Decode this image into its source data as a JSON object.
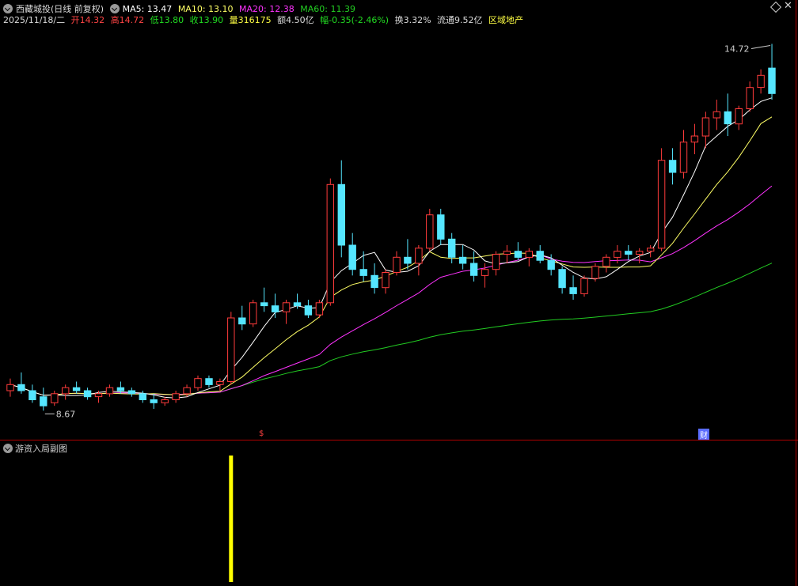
{
  "header": {
    "stock": "西藏城投",
    "mode": "(日线 前复权)",
    "ma5": "MA5: 13.47",
    "ma10": "MA10: 13.10",
    "ma20": "MA20: 12.38",
    "ma60": "MA60: 11.39",
    "date": "2025/11/18/二",
    "open_label": "开",
    "open": "14.32",
    "high_label": "高",
    "high": "14.72",
    "low_label": "低",
    "low": "13.80",
    "close_label": "收",
    "close": "13.90",
    "vol_label": "量",
    "vol": "316175",
    "amount_label": "额",
    "amount": "4.50亿",
    "chg_label": "幅",
    "chg": "-0.35(-2.46%)",
    "turnover_label": "换",
    "turnover": "3.32%",
    "float_label": "流通",
    "float": "9.52亿",
    "sector": "区域地产"
  },
  "colors": {
    "up": "#ff3b3b",
    "down": "#55e6ff",
    "ma5": "#ffffff",
    "ma10": "#ffff66",
    "ma20": "#ff33ff",
    "ma60": "#22cc22"
  },
  "annotations": {
    "high_label": "14.72",
    "low_label": "8.67",
    "s_badge": "$",
    "fin_badge": "财"
  },
  "subchart": {
    "title": "游资入局副图",
    "bar_color": "#ffff00"
  },
  "chart_data": {
    "type": "candlestick",
    "ohlc": [
      [
        9.0,
        9.2,
        8.9,
        9.1
      ],
      [
        9.1,
        9.3,
        8.95,
        9.0
      ],
      [
        9.0,
        9.1,
        8.8,
        8.85
      ],
      [
        8.9,
        9.05,
        8.67,
        8.75
      ],
      [
        8.8,
        9.0,
        8.75,
        8.95
      ],
      [
        8.95,
        9.1,
        8.85,
        9.05
      ],
      [
        9.05,
        9.15,
        8.95,
        9.0
      ],
      [
        9.0,
        9.05,
        8.85,
        8.9
      ],
      [
        8.9,
        9.0,
        8.8,
        8.95
      ],
      [
        8.95,
        9.1,
        8.9,
        9.05
      ],
      [
        9.05,
        9.15,
        8.95,
        9.0
      ],
      [
        9.0,
        9.05,
        8.9,
        8.95
      ],
      [
        8.95,
        9.0,
        8.8,
        8.85
      ],
      [
        8.85,
        8.95,
        8.7,
        8.8
      ],
      [
        8.8,
        8.9,
        8.75,
        8.85
      ],
      [
        8.85,
        9.0,
        8.8,
        8.95
      ],
      [
        8.95,
        9.1,
        8.9,
        9.05
      ],
      [
        9.05,
        9.25,
        9.0,
        9.2
      ],
      [
        9.2,
        9.25,
        9.05,
        9.1
      ],
      [
        9.1,
        9.2,
        9.0,
        9.15
      ],
      [
        9.15,
        10.3,
        9.1,
        10.2
      ],
      [
        10.2,
        10.4,
        10.0,
        10.1
      ],
      [
        10.1,
        10.5,
        10.05,
        10.45
      ],
      [
        10.45,
        10.7,
        10.3,
        10.4
      ],
      [
        10.4,
        10.6,
        10.2,
        10.3
      ],
      [
        10.3,
        10.5,
        10.1,
        10.45
      ],
      [
        10.45,
        10.6,
        10.35,
        10.4
      ],
      [
        10.4,
        10.5,
        10.2,
        10.25
      ],
      [
        10.25,
        10.5,
        10.2,
        10.45
      ],
      [
        10.45,
        12.5,
        10.4,
        12.4
      ],
      [
        12.4,
        12.8,
        11.2,
        11.4
      ],
      [
        11.4,
        11.6,
        10.9,
        11.0
      ],
      [
        11.0,
        11.3,
        10.8,
        10.9
      ],
      [
        10.9,
        11.1,
        10.6,
        10.7
      ],
      [
        10.7,
        11.0,
        10.6,
        10.95
      ],
      [
        10.95,
        11.3,
        10.9,
        11.2
      ],
      [
        11.2,
        11.5,
        11.0,
        11.1
      ],
      [
        11.1,
        11.4,
        10.9,
        11.35
      ],
      [
        11.35,
        12.0,
        11.3,
        11.9
      ],
      [
        11.9,
        12.0,
        11.4,
        11.5
      ],
      [
        11.5,
        11.6,
        11.1,
        11.2
      ],
      [
        11.2,
        11.4,
        11.0,
        11.1
      ],
      [
        11.1,
        11.3,
        10.8,
        10.9
      ],
      [
        10.9,
        11.1,
        10.7,
        11.0
      ],
      [
        11.0,
        11.3,
        10.9,
        11.25
      ],
      [
        11.25,
        11.4,
        11.1,
        11.3
      ],
      [
        11.3,
        11.45,
        11.15,
        11.2
      ],
      [
        11.2,
        11.35,
        11.05,
        11.3
      ],
      [
        11.3,
        11.4,
        11.1,
        11.15
      ],
      [
        11.15,
        11.25,
        10.9,
        11.0
      ],
      [
        11.0,
        11.05,
        10.6,
        10.7
      ],
      [
        10.7,
        10.9,
        10.5,
        10.6
      ],
      [
        10.6,
        10.9,
        10.55,
        10.85
      ],
      [
        10.85,
        11.1,
        10.8,
        11.05
      ],
      [
        11.05,
        11.25,
        10.95,
        11.2
      ],
      [
        11.2,
        11.4,
        11.1,
        11.3
      ],
      [
        11.3,
        11.4,
        11.15,
        11.25
      ],
      [
        11.25,
        11.35,
        11.1,
        11.3
      ],
      [
        11.3,
        11.4,
        11.2,
        11.35
      ],
      [
        11.35,
        13.0,
        11.3,
        12.8
      ],
      [
        12.8,
        13.0,
        12.4,
        12.6
      ],
      [
        12.6,
        13.3,
        12.5,
        13.1
      ],
      [
        13.1,
        13.4,
        12.9,
        13.2
      ],
      [
        13.2,
        13.6,
        13.0,
        13.5
      ],
      [
        13.5,
        13.8,
        13.3,
        13.6
      ],
      [
        13.6,
        13.9,
        13.2,
        13.4
      ],
      [
        13.4,
        13.7,
        13.3,
        13.65
      ],
      [
        13.65,
        14.1,
        13.6,
        14.0
      ],
      [
        14.0,
        14.3,
        13.9,
        14.2
      ],
      [
        14.32,
        14.72,
        13.8,
        13.9
      ]
    ],
    "ma5": "13.47",
    "ma10": "13.10",
    "ma20": "12.38",
    "ma60": "11.39",
    "y_range": [
      8.4,
      15.0
    ],
    "sub_bar_index": 20
  }
}
